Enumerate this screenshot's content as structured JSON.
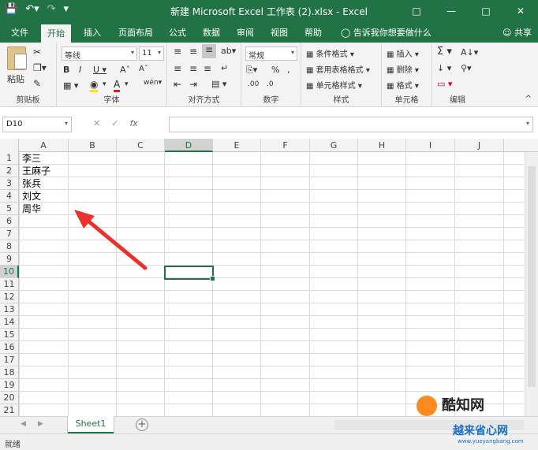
{
  "window": {
    "title": "新建 Microsoft Excel 工作表 (2).xlsx - Excel",
    "accent": "#217346"
  },
  "qat": [
    "save-icon",
    "undo-icon",
    "redo-icon",
    "customize-icon"
  ],
  "tabs": [
    "文件",
    "开始",
    "插入",
    "页面布局",
    "公式",
    "数据",
    "审阅",
    "视图",
    "帮助"
  ],
  "active_tab": "开始",
  "tell_me": "告诉我你想要做什么",
  "share": "共享",
  "ribbon": {
    "clipboard": {
      "label": "剪贴板",
      "paste": "粘贴"
    },
    "font": {
      "label": "字体",
      "name": "等线",
      "size": "11"
    },
    "alignment": {
      "label": "对齐方式"
    },
    "number": {
      "label": "数字",
      "format": "常规"
    },
    "styles": {
      "label": "样式",
      "conditional": "条件格式",
      "table": "套用表格格式",
      "cell_styles": "单元格样式"
    },
    "cells": {
      "label": "单元格",
      "insert": "插入",
      "delete": "删除",
      "format": "格式"
    },
    "editing": {
      "label": "编辑"
    }
  },
  "formula_bar": {
    "name_box": "D10",
    "value": ""
  },
  "columns": [
    "A",
    "B",
    "C",
    "D",
    "E",
    "F",
    "G",
    "H",
    "I",
    "J"
  ],
  "rows": [
    "1",
    "2",
    "3",
    "4",
    "5",
    "6",
    "7",
    "8",
    "9",
    "10",
    "11",
    "12",
    "13",
    "14",
    "15",
    "16",
    "17",
    "18",
    "19",
    "20",
    "21"
  ],
  "selected_cell": {
    "column": "D",
    "row": "10"
  },
  "cells": [
    {
      "ref": "A1",
      "value": "李三"
    },
    {
      "ref": "A2",
      "value": "王麻子"
    },
    {
      "ref": "A3",
      "value": "张兵"
    },
    {
      "ref": "A4",
      "value": "刘文"
    },
    {
      "ref": "A5",
      "value": "周华"
    }
  ],
  "sheets": [
    "Sheet1"
  ],
  "status": "就绪",
  "watermark": {
    "brand": "酷知网",
    "site": "越来省心网",
    "url": "www.yueyangbang.com"
  }
}
